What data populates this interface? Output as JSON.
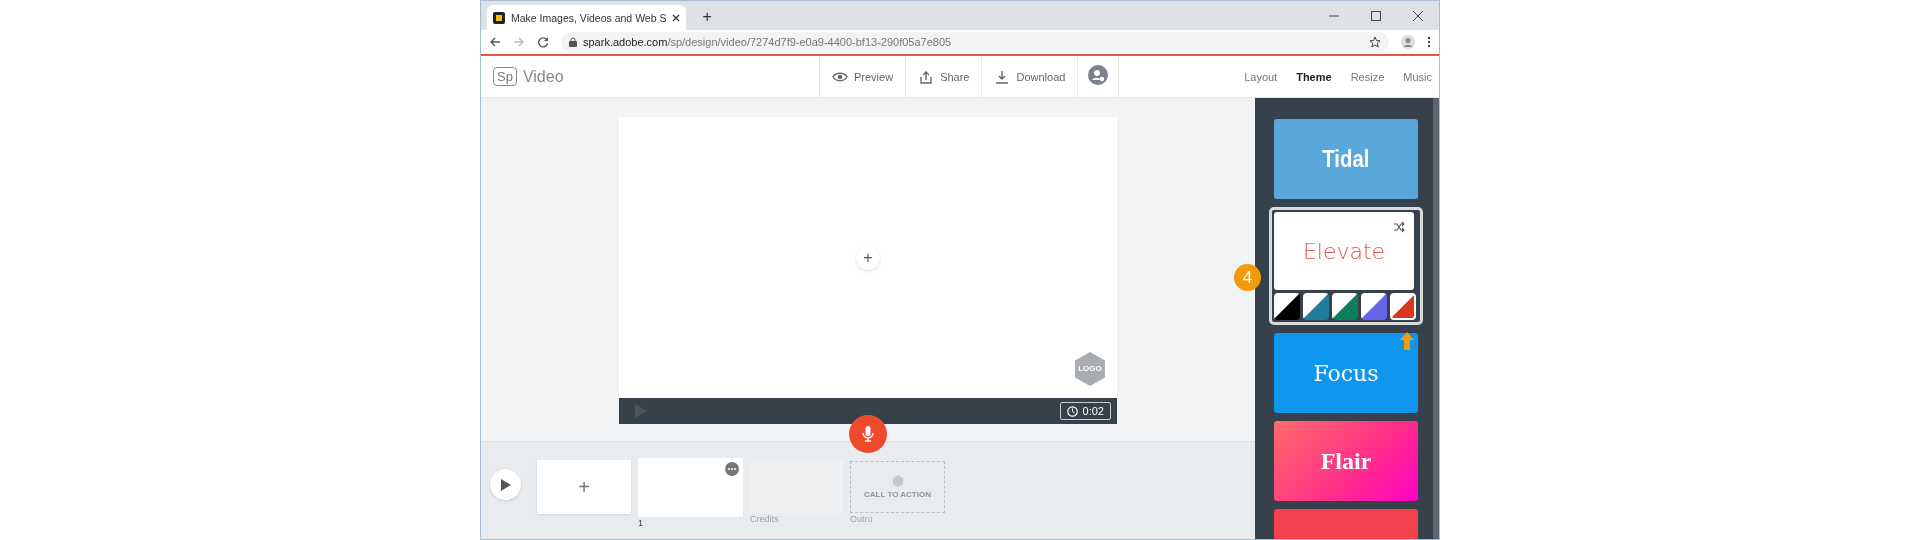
{
  "browser": {
    "tab_title": "Make Images, Videos and Web S",
    "new_tab": "+",
    "url_domain": "spark.adobe.com",
    "url_path": "/sp/design/video/7274d7f9-e0a9-4400-bf13-290f05a7e805"
  },
  "app": {
    "logo_mark": "Sp",
    "product": "Video",
    "actions": [
      {
        "kind": "preview",
        "label": "Preview"
      },
      {
        "kind": "share",
        "label": "Share"
      },
      {
        "kind": "download",
        "label": "Download"
      },
      {
        "kind": "account"
      }
    ],
    "nav": [
      {
        "label": "Layout",
        "selected": false
      },
      {
        "label": "Theme",
        "selected": true
      },
      {
        "label": "Resize",
        "selected": false
      },
      {
        "label": "Music",
        "selected": false
      }
    ]
  },
  "canvas": {
    "add": "+",
    "logo_placeholder": "LOGO",
    "duration": "0:02"
  },
  "timeline": {
    "add": "+",
    "slides": [
      {
        "kind": "scene",
        "label": "1"
      },
      {
        "kind": "credits",
        "label": "Credits"
      },
      {
        "kind": "outro",
        "label": "Outro",
        "text": "CALL TO ACTION"
      }
    ]
  },
  "themes": [
    {
      "name": "Tidal",
      "kind": "condensed",
      "color": "#5aa7dc",
      "selected": false
    },
    {
      "name": "Elevate",
      "kind": "light",
      "color": "#ffffff",
      "selected": true,
      "swatches": [
        {
          "color": "#000000",
          "selected": false
        },
        {
          "color": "#1f7f9a",
          "selected": false
        },
        {
          "color": "#0b7f5b",
          "selected": false
        },
        {
          "color": "#6466e6",
          "selected": false
        },
        {
          "color": "#d9391f",
          "selected": true
        }
      ]
    },
    {
      "name": "Focus",
      "kind": "slab",
      "color": "#0f97f0",
      "selected": false
    },
    {
      "name": "Flair",
      "kind": "display",
      "color": "#ff2d8a",
      "selected": false
    },
    {
      "kind": "partial",
      "color": "#f4414f",
      "selected": false
    }
  ],
  "annotation": {
    "step": "4"
  }
}
